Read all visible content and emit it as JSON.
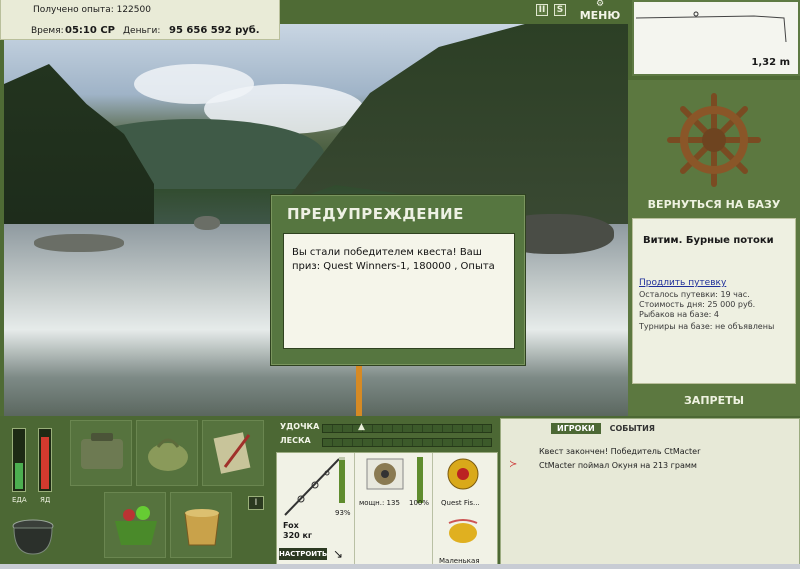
{
  "info": {
    "experience": "Получено опыта: 122500",
    "time_label": "Время:",
    "time_value": "05:10 СР",
    "money_label": "Деньги:",
    "money_value": "95 656 592 руб."
  },
  "toolbar": {
    "pause_label": "II",
    "sound_label": "S",
    "menu_label": "МЕНЮ"
  },
  "depth": {
    "value": "1,32 m"
  },
  "right_panel": {
    "return_label": "ВЕРНУТЬСЯ НА БАЗУ",
    "location_title": "Витим. Бурные потоки",
    "extend_link": "Продлить путевку",
    "lines": [
      "Осталось путевки: 19 час.",
      "Стоимость дня: 25 000 руб.",
      "Рыбаков на базе: 4",
      "Турниры на базе: не объявлены"
    ],
    "bans_label": "ЗАПРЕТЫ"
  },
  "dialog": {
    "title": "ПРЕДУПРЕЖДЕНИЕ",
    "message": "Вы стали победителем квеста! Ваш приз: Quest Winners-1, 180000 , Опыта"
  },
  "status": {
    "food_label": "ЕДА",
    "poison_label": "ЯД",
    "food_level": 0.45,
    "poison_level": 0.9
  },
  "bars": {
    "rod_label": "УДОЧКА",
    "line_label": "ЛЕСКА"
  },
  "tackle": {
    "rod_name": "Fox",
    "rod_weight": "320 кг",
    "rod_pct": "93%",
    "tune_label": "НАСТРОИТЬ",
    "reel_power": "мощн.: 135",
    "reel_pct": "100%",
    "line_name": "Quest Fis...",
    "lure_name": "Маленькая"
  },
  "misc": {
    "slot_button": "I"
  },
  "chat": {
    "tab_players": "ИГРОКИ",
    "tab_events": "СОБЫТИЯ",
    "messages": [
      "Квест закончен! Победитель CtMacter",
      "CtMacter поймал Окуня на 213 грамм"
    ]
  },
  "colors": {
    "panel_green": "#4c6834",
    "light_panel": "#eef0e1",
    "food_green": "#4caf50",
    "poison_red": "#d23a2e"
  }
}
